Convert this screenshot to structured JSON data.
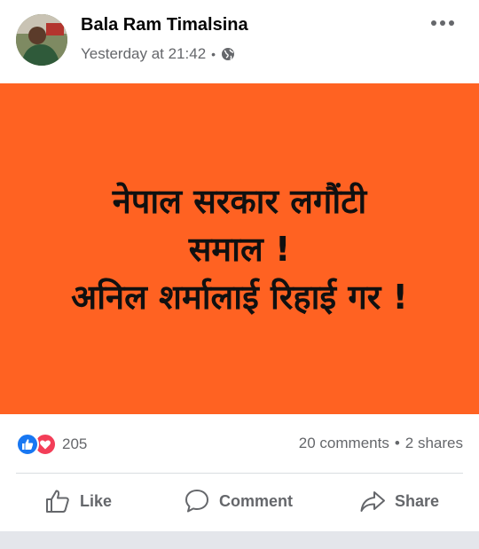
{
  "post": {
    "author": "Bala Ram Timalsina",
    "timestamp": "Yesterday at 21:42",
    "privacy_icon": "globe-icon",
    "more_icon": "more-options-icon"
  },
  "banner": {
    "background_color": "#ff6222",
    "lines": [
      "नेपाल सरकार लगौंटी",
      "समाल !",
      "अनिल शर्मालाई रिहाई गर !"
    ]
  },
  "stats": {
    "reaction_icons": [
      "like-icon",
      "love-icon"
    ],
    "reaction_count": "205",
    "comments": "20 comments",
    "shares": "2 shares"
  },
  "actions": {
    "like": "Like",
    "comment": "Comment",
    "share": "Share"
  }
}
